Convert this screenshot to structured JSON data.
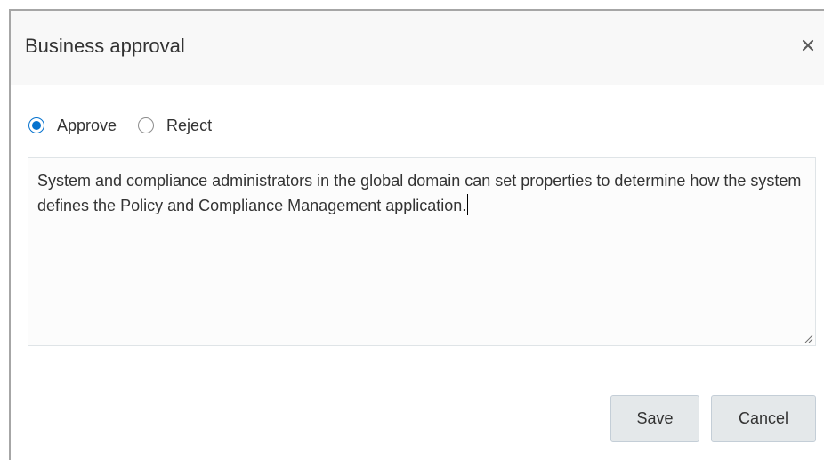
{
  "dialog": {
    "title": "Business approval",
    "close_icon": "close-icon"
  },
  "decision": {
    "options": [
      {
        "label": "Approve",
        "checked": true
      },
      {
        "label": "Reject",
        "checked": false
      }
    ]
  },
  "comment": {
    "value": "System and compliance administrators in the global domain can set properties to determine how the system defines the Policy and Compliance Management application."
  },
  "actions": {
    "save_label": "Save",
    "cancel_label": "Cancel"
  },
  "colors": {
    "accent": "#0572ce",
    "header_bg": "#f8f8f8",
    "button_bg": "#e4e8ea"
  }
}
